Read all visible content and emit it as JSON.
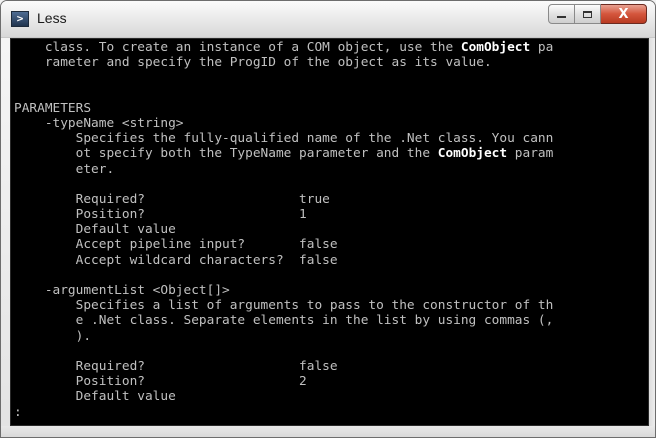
{
  "window": {
    "title": "Less",
    "icon": "powershell-icon",
    "controls": {
      "minimize": "minimize",
      "maximize": "maximize",
      "close": "X"
    }
  },
  "console": {
    "lines": [
      [
        {
          "t": "    class. To create an instance of a COM object, use the "
        },
        {
          "t": "ComObject",
          "hl": true
        },
        {
          "t": " pa"
        }
      ],
      [
        {
          "t": "    rameter and specify the ProgID of the object as its value."
        }
      ],
      [
        {
          "t": ""
        }
      ],
      [
        {
          "t": ""
        }
      ],
      [
        {
          "t": "PARAMETERS"
        }
      ],
      [
        {
          "t": "    -typeName <string>"
        }
      ],
      [
        {
          "t": "        Specifies the fully-qualified name of the .Net class. You cann"
        }
      ],
      [
        {
          "t": "        ot specify both the TypeName parameter and the "
        },
        {
          "t": "ComObject",
          "hl": true
        },
        {
          "t": " param"
        }
      ],
      [
        {
          "t": "        eter."
        }
      ],
      [
        {
          "t": ""
        }
      ],
      [
        {
          "t": "        Required?                    true"
        }
      ],
      [
        {
          "t": "        Position?                    1"
        }
      ],
      [
        {
          "t": "        Default value"
        }
      ],
      [
        {
          "t": "        Accept pipeline input?       false"
        }
      ],
      [
        {
          "t": "        Accept wildcard characters?  false"
        }
      ],
      [
        {
          "t": ""
        }
      ],
      [
        {
          "t": "    -argumentList <Object[]>"
        }
      ],
      [
        {
          "t": "        Specifies a list of arguments to pass to the constructor of th"
        }
      ],
      [
        {
          "t": "        e .Net class. Separate elements in the list by using commas (,"
        }
      ],
      [
        {
          "t": "        )."
        }
      ],
      [
        {
          "t": ""
        }
      ],
      [
        {
          "t": "        Required?                    false"
        }
      ],
      [
        {
          "t": "        Position?                    2"
        }
      ],
      [
        {
          "t": "        Default value"
        }
      ],
      [
        {
          "t": "",
          "cursor": true
        }
      ]
    ],
    "prompt": ":"
  },
  "colors": {
    "background": "#000000",
    "text": "#c0c0c0",
    "highlight": "#ffffff"
  }
}
